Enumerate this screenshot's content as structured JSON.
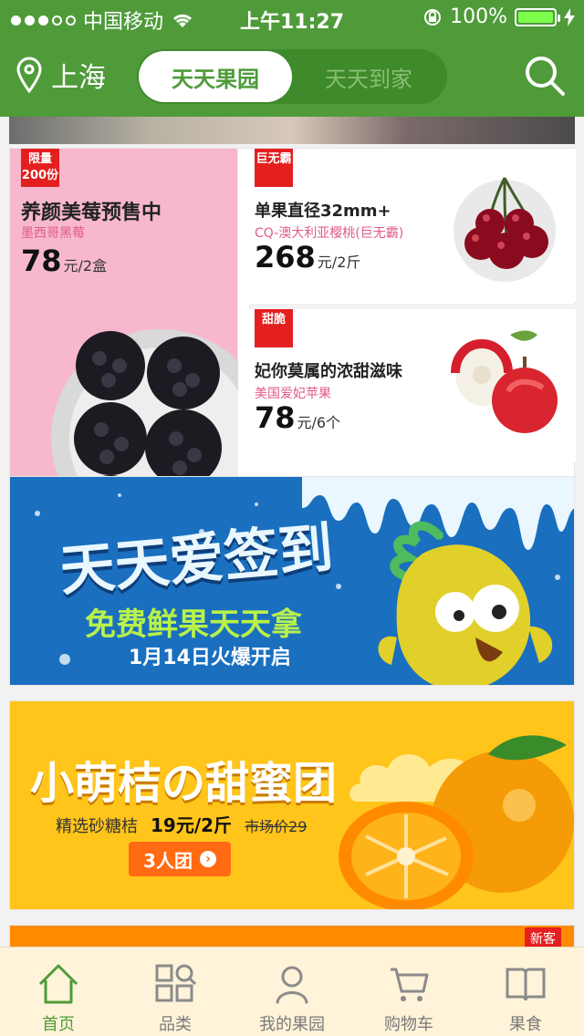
{
  "status": {
    "carrier": "中国移动",
    "time": "上午11:27",
    "battery": "100%"
  },
  "header": {
    "city": "上海",
    "tabs": [
      "天天果园",
      "天天到家"
    ],
    "active_tab": 0
  },
  "products": [
    {
      "tag": "限量200份",
      "title": "养颜美莓预售中",
      "subtitle": "墨西哥黑莓",
      "price": "78",
      "unit": "元/2盒"
    },
    {
      "tag": "巨无霸",
      "title": "单果直径32mm+",
      "subtitle": "CQ-澳大利亚樱桃(巨无霸)",
      "price": "268",
      "unit": "元/2斤"
    },
    {
      "tag": "甜脆",
      "title": "妃你莫属的浓甜滋味",
      "subtitle": "美国爱妃苹果",
      "price": "78",
      "unit": "元/6个"
    }
  ],
  "banners": [
    {
      "headline": "天天爱签到",
      "subline": "免费鲜果天天拿",
      "date": "1月14日火爆开启"
    },
    {
      "headline": "小萌桔の甜蜜团",
      "desc": "精选砂糖桔",
      "price": "19元/2斤",
      "market_price": "市场价29",
      "button": "3人团"
    },
    {
      "tag": "新客"
    }
  ],
  "nav": [
    {
      "label": "首页",
      "icon": "home-icon",
      "active": true
    },
    {
      "label": "品类",
      "icon": "category-icon",
      "active": false
    },
    {
      "label": "我的果园",
      "icon": "profile-icon",
      "active": false
    },
    {
      "label": "购物车",
      "icon": "cart-icon",
      "active": false
    },
    {
      "label": "果食",
      "icon": "book-icon",
      "active": false
    }
  ],
  "colors": {
    "brand_green": "#4f9b3a",
    "tag_red": "#e41f1f",
    "pink": "#e15a88"
  }
}
